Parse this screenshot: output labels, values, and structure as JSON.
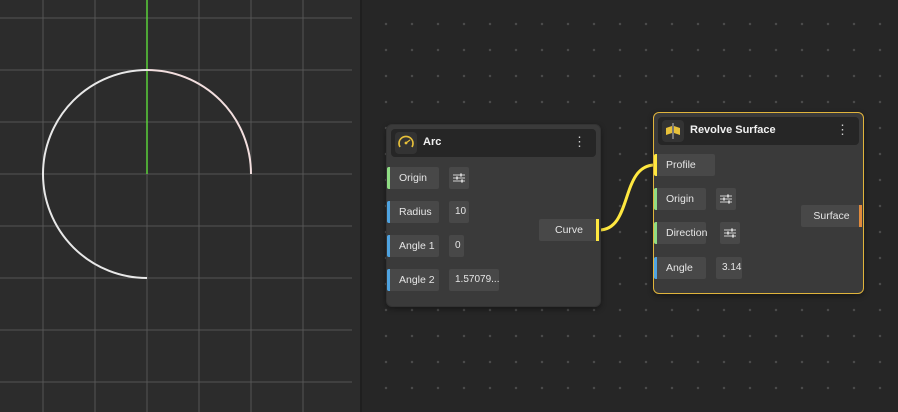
{
  "colors": {
    "accent_selected": "#e0b43c",
    "wire": "#ffe840",
    "port_green": "#8fdc84",
    "port_blue": "#4fa3e0",
    "port_output_yellow": "#ffe840",
    "port_output_orange": "#e08a3c",
    "axis_x": "#d03b2a",
    "axis_y": "#5ad03a",
    "curve": "#e8e8e8"
  },
  "arc_node": {
    "title": "Arc",
    "icon": "arc-icon",
    "menu_icon": "more-vertical-icon",
    "inputs": [
      {
        "label": "Origin",
        "kind": "vector",
        "value": ""
      },
      {
        "label": "Radius",
        "kind": "number",
        "value": "10"
      },
      {
        "label": "Angle 1",
        "kind": "number",
        "value": "0"
      },
      {
        "label": "Angle 2",
        "kind": "number",
        "value": "1.57079..."
      }
    ],
    "output": "Curve"
  },
  "revolve_node": {
    "title": "Revolve Surface",
    "icon": "revolve-surface-icon",
    "menu_icon": "more-vertical-icon",
    "inputs": [
      {
        "label": "Profile",
        "kind": "curve",
        "value": ""
      },
      {
        "label": "Origin",
        "kind": "vector",
        "value": ""
      },
      {
        "label": "Direction",
        "kind": "vector",
        "value": ""
      },
      {
        "label": "Angle",
        "kind": "number",
        "value": "3.14"
      }
    ],
    "output": "Surface"
  }
}
